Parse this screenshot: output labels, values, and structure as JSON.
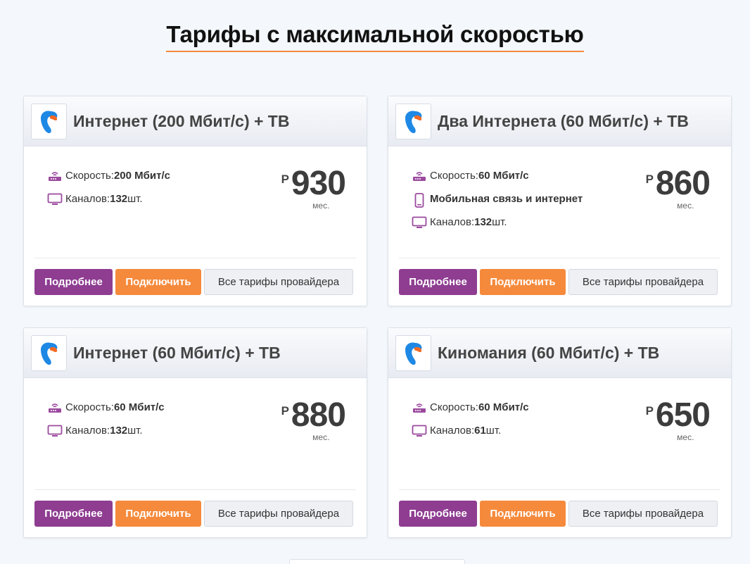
{
  "page": {
    "title": "Тарифы с максимальной скоростью"
  },
  "colors": {
    "accent_orange": "#f58a3c",
    "accent_purple": "#8e3d91",
    "icon_purple": "#9b4a9e"
  },
  "cards": [
    {
      "title": "Интернет (200 Мбит/с) + ТВ",
      "features": [
        {
          "icon": "router-icon",
          "label": "Скорость: ",
          "value": "200 Мбит/с"
        },
        {
          "icon": "tv-icon",
          "label": "Каналов: ",
          "value": "132",
          "suffix": " шт."
        }
      ],
      "price": {
        "currency": "Р",
        "value": "930",
        "period": "мес."
      },
      "buttons": {
        "more": "Подробнее",
        "connect": "Подключить",
        "all": "Все тарифы провайдера"
      }
    },
    {
      "title": "Два Интернета (60 Мбит/с) + ТВ",
      "features": [
        {
          "icon": "router-icon",
          "label": "Скорость: ",
          "value": "60 Мбит/с"
        },
        {
          "icon": "phone-icon",
          "label": "",
          "value": "Мобильная связь и интернет"
        },
        {
          "icon": "tv-icon",
          "label": "Каналов: ",
          "value": "132",
          "suffix": " шт."
        }
      ],
      "price": {
        "currency": "Р",
        "value": "860",
        "period": "мес."
      },
      "buttons": {
        "more": "Подробнее",
        "connect": "Подключить",
        "all": "Все тарифы провайдера"
      }
    },
    {
      "title": "Интернет (60 Мбит/с) + ТВ",
      "features": [
        {
          "icon": "router-icon",
          "label": "Скорость: ",
          "value": "60 Мбит/с"
        },
        {
          "icon": "tv-icon",
          "label": "Каналов: ",
          "value": "132",
          "suffix": " шт."
        }
      ],
      "price": {
        "currency": "Р",
        "value": "880",
        "period": "мес."
      },
      "buttons": {
        "more": "Подробнее",
        "connect": "Подключить",
        "all": "Все тарифы провайдера"
      }
    },
    {
      "title": "Киномания (60 Мбит/с) + ТВ",
      "features": [
        {
          "icon": "router-icon",
          "label": "Скорость: ",
          "value": "60 Мбит/с"
        },
        {
          "icon": "tv-icon",
          "label": "Каналов: ",
          "value": "61",
          "suffix": " шт."
        }
      ],
      "price": {
        "currency": "Р",
        "value": "650",
        "period": "мес."
      },
      "buttons": {
        "more": "Подробнее",
        "connect": "Подключить",
        "all": "Все тарифы провайдера"
      }
    }
  ]
}
